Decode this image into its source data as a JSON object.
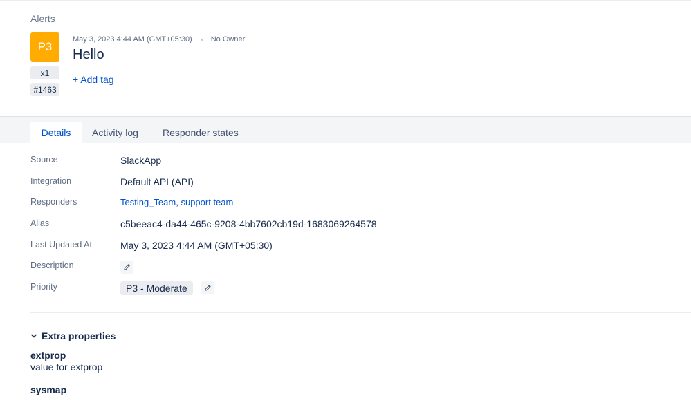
{
  "breadcrumb": "Alerts",
  "alert": {
    "priority": "P3",
    "count": "x1",
    "id": "#1463",
    "timestamp": "May 3, 2023 4:44 AM (GMT+05:30)",
    "owner": "No Owner",
    "title": "Hello",
    "add_tag": "+ Add tag",
    "priority_color": "#ffab00"
  },
  "tabs": [
    {
      "label": "Details",
      "active": true
    },
    {
      "label": "Activity log",
      "active": false
    },
    {
      "label": "Responder states",
      "active": false
    }
  ],
  "details": {
    "source": {
      "label": "Source",
      "value": "SlackApp"
    },
    "integration": {
      "label": "Integration",
      "value": "Default API (API)"
    },
    "responders": {
      "label": "Responders",
      "values": [
        "Testing_Team",
        "support team"
      ],
      "separator": ","
    },
    "alias": {
      "label": "Alias",
      "value": "c5beeac4-da44-465c-9208-4bb7602cb19d-1683069264578"
    },
    "last_updated": {
      "label": "Last Updated At",
      "value": "May 3, 2023 4:44 AM (GMT+05:30)"
    },
    "description": {
      "label": "Description"
    },
    "priority": {
      "label": "Priority",
      "value": "P3 - Moderate"
    }
  },
  "extra_properties": {
    "title": "Extra properties",
    "items": [
      {
        "key": "extprop",
        "value": "value for extprop"
      },
      {
        "key": "sysmap",
        "value": ""
      }
    ]
  },
  "colors": {
    "link": "#0052cc",
    "text": "#172b4d",
    "muted": "#5e6c84"
  }
}
